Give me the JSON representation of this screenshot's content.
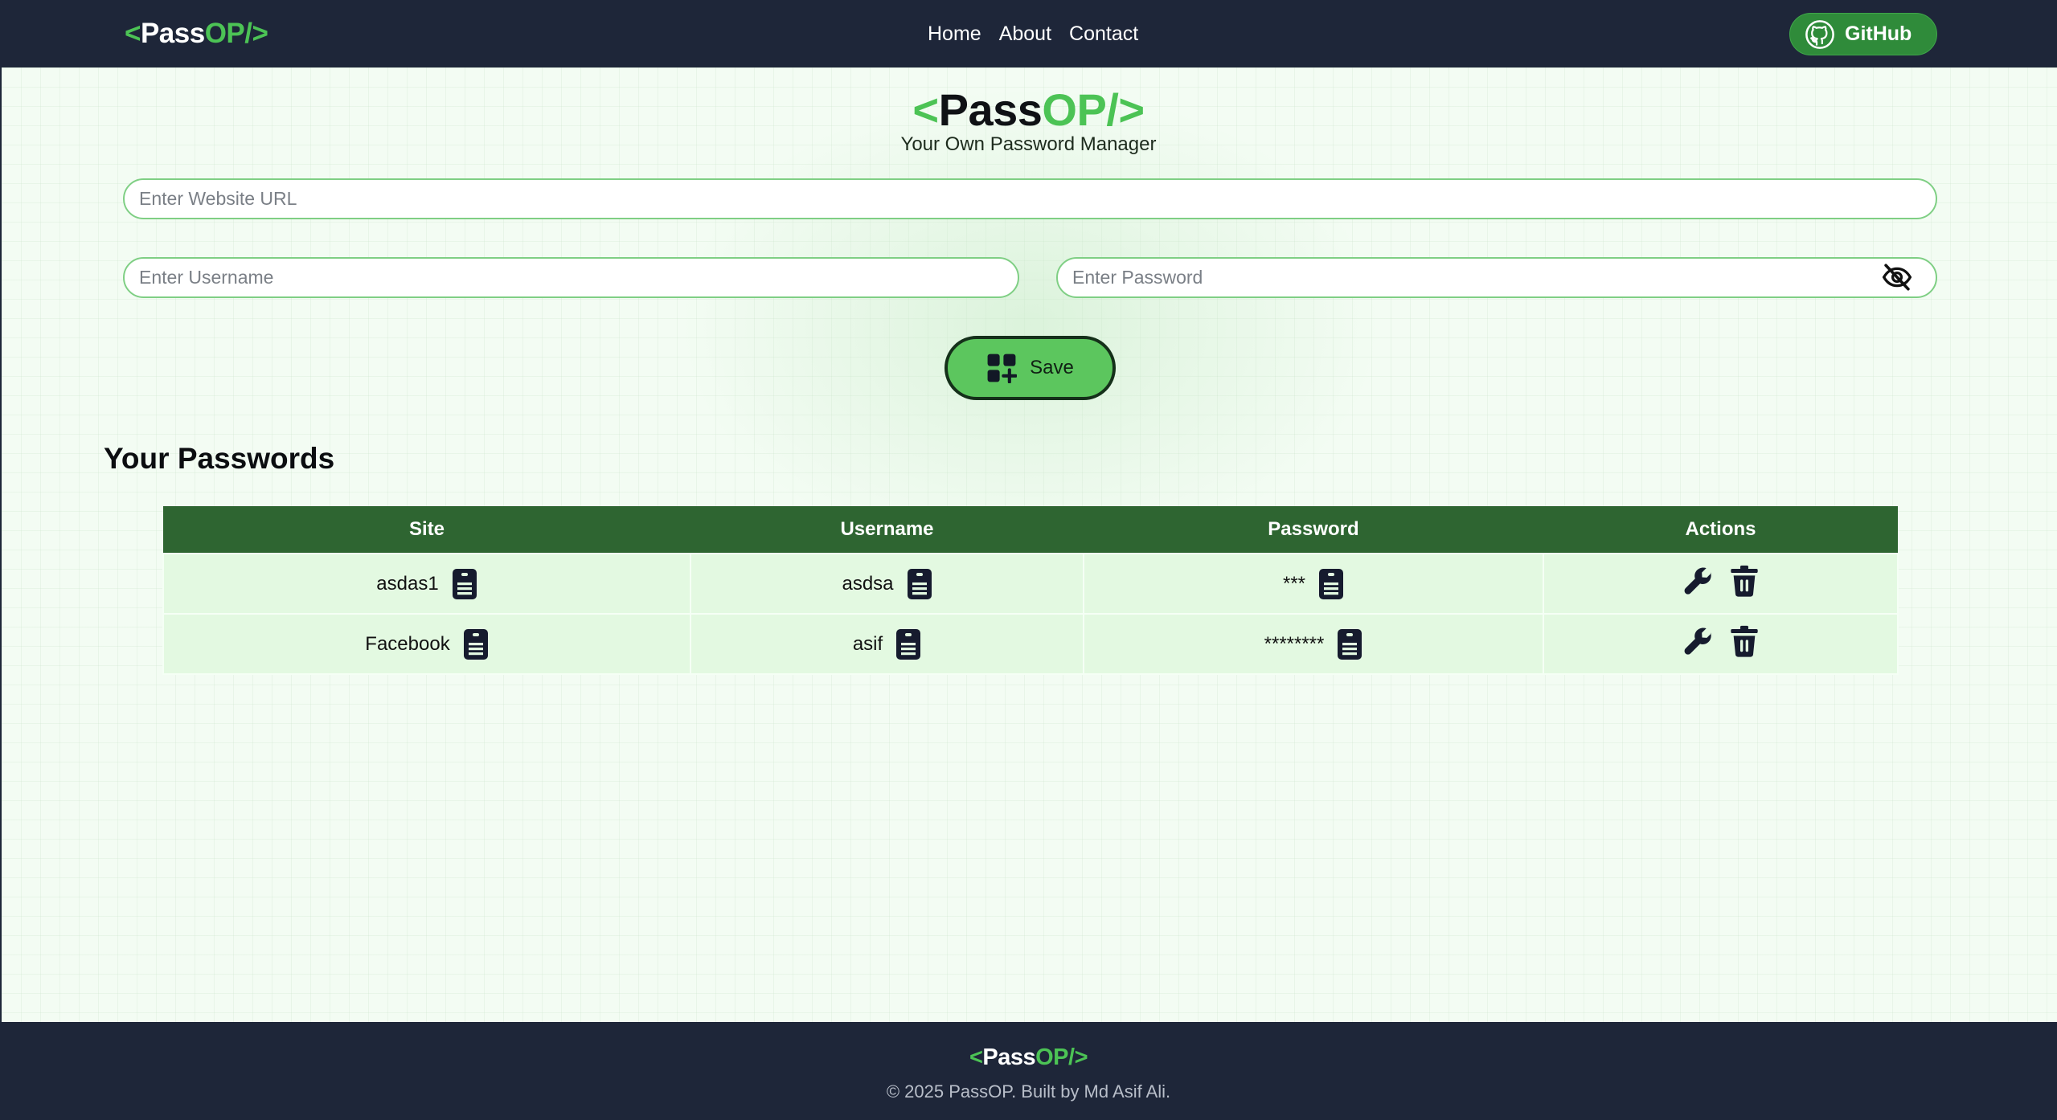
{
  "brand": {
    "open": "<",
    "pass": "Pass",
    "op": "OP/",
    "close": ">"
  },
  "nav": {
    "links": [
      "Home",
      "About",
      "Contact"
    ],
    "github_label": "GitHub"
  },
  "hero": {
    "subtitle": "Your Own Password Manager"
  },
  "form": {
    "url_placeholder": "Enter Website URL",
    "username_placeholder": "Enter Username",
    "password_placeholder": "Enter Password",
    "save_label": "Save"
  },
  "passwords": {
    "title": "Your Passwords",
    "columns": [
      "Site",
      "Username",
      "Password",
      "Actions"
    ],
    "rows": [
      {
        "site": "asdas1",
        "username": "asdsa",
        "password": "***"
      },
      {
        "site": "Facebook",
        "username": "asif",
        "password": "********"
      }
    ]
  },
  "footer": {
    "copyright": "© 2025 PassOP. Built by Md Asif Ali."
  },
  "colors": {
    "accent": "#4cc355",
    "navbar": "#1e2639",
    "table_header": "#2e6531",
    "row_bg": "#e3f9e1"
  }
}
